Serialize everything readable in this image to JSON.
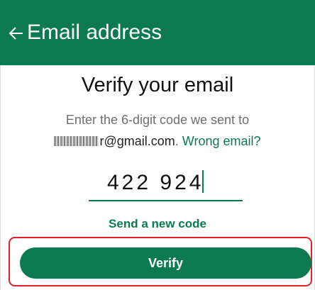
{
  "header": {
    "title": "Email address",
    "back_icon": "arrow-left-icon",
    "background_color": "#0b7a52"
  },
  "main": {
    "heading": "Verify your email",
    "instructions": "Enter the 6-digit code we sent to",
    "email_obscured_part": "mhirrrr",
    "email_domain": "r@gmail.com",
    "email_separator": ". ",
    "wrong_email_link": "Wrong email?",
    "code_value": "422 924",
    "resend_link": "Send a new code",
    "verify_button": "Verify"
  },
  "colors": {
    "accent": "#0b7a52",
    "highlight_frame": "#e0202a"
  }
}
